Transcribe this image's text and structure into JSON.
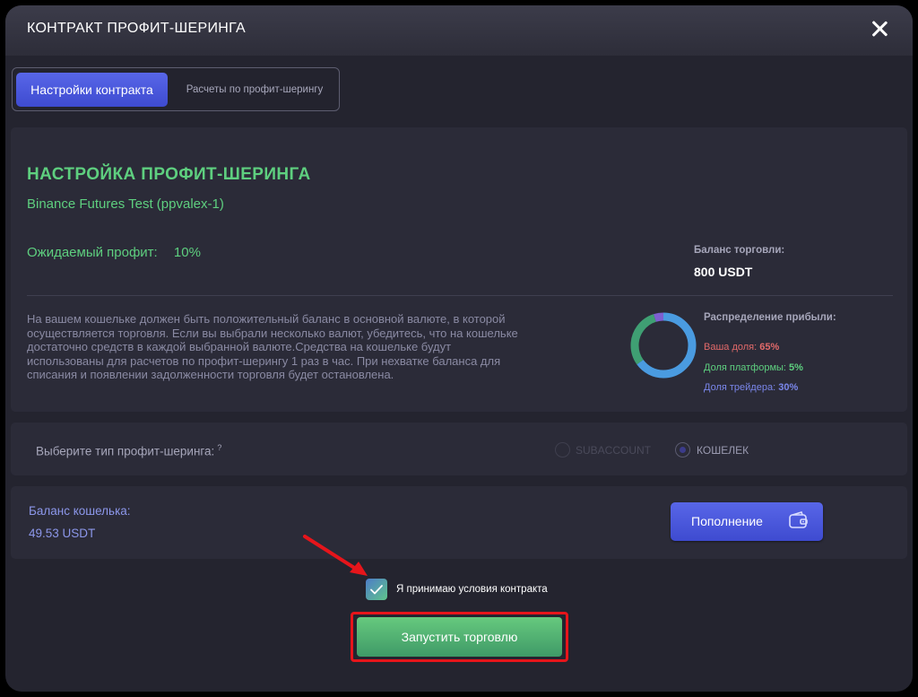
{
  "modal": {
    "title": "КОНТРАКТ ПРОФИТ-ШЕРИНГА"
  },
  "tabs": [
    {
      "label": "Настройки контракта",
      "active": true
    },
    {
      "label": "Расчеты по профит-шерингу",
      "active": false
    }
  ],
  "settings": {
    "title": "НАСТРОЙКА ПРОФИТ-ШЕРИНГА",
    "account": "Binance Futures Test (ppvalex-1)",
    "expected_profit_label": "Ожидаемый профит:",
    "expected_profit_value": "10%",
    "trading_balance_label": "Баланс торговли:",
    "trading_balance_value": "800 USDT",
    "info_text": "На вашем кошельке должен быть положительный баланс в основной валюте, в которой осуществляется торговля. Если вы выбрали несколько валют, убедитесь, что на кошельке достаточно средств в каждой выбранной валюте.Средства на кошельке будут использованы для расчетов по профит-шерингу 1 раз в час. При нехватке баланса для списания и появлении задолженности торговля будет остановлена.",
    "distribution": {
      "label": "Распределение прибыли:",
      "items": [
        {
          "label": "Ваша доля:",
          "value": "65%",
          "percent": 65,
          "color": "#4a9be0"
        },
        {
          "label": "Доля платформы:",
          "value": "5%",
          "percent": 5,
          "color": "#7d5fd0"
        },
        {
          "label": "Доля трейдера:",
          "value": "30%",
          "percent": 30,
          "color": "#3f9f73"
        }
      ]
    }
  },
  "sharing_type": {
    "label": "Выберите тип профит-шеринга:",
    "help": "?",
    "options": [
      {
        "label": "SUBACCOUNT",
        "selected": false
      },
      {
        "label": "КОШЕЛЕК",
        "selected": true
      }
    ]
  },
  "wallet": {
    "balance_label": "Баланс кошелька:",
    "balance_value": "49.53 USDT",
    "topup_label": "Пополнение"
  },
  "agreement": {
    "label": "Я принимаю условия контракта",
    "checked": true
  },
  "start_button": {
    "label": "Запустить торговлю"
  },
  "colors": {
    "accent_blue": "#4c59df",
    "accent_green": "#5ecf7f",
    "highlight_red": "#e6151b"
  }
}
